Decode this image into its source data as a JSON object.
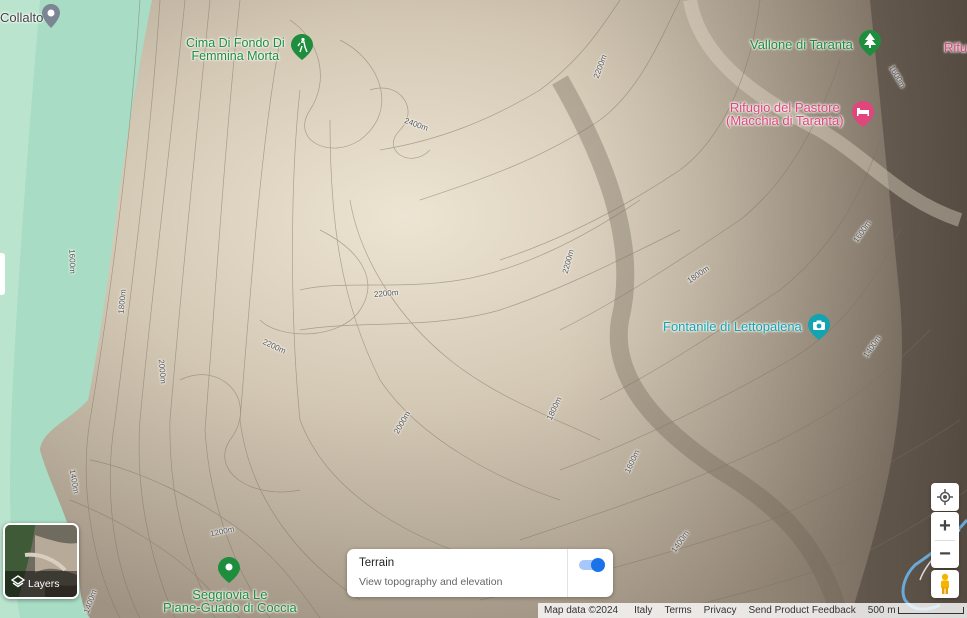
{
  "pois": {
    "collalto": "Collalto",
    "cima_line1": "Cima Di Fondo Di",
    "cima_line2": "Femmina Morta",
    "vallone": "Vallone di Taranta",
    "rifu": "Rifu",
    "rifugio_line1": "Rifugio del Pastore",
    "rifugio_line2": "(Macchia di Taranta)",
    "fontanile": "Fontanile di Lettopalena",
    "seggiovia_line1": "Seggiovia Le",
    "seggiovia_line2": "Piane-Guado di Coccia"
  },
  "contours": {
    "c2400": "2400m",
    "c2200a": "2200m",
    "c2200b": "2200m",
    "c2200c": "2200m",
    "c2200d": "2200m",
    "c2000a": "2000m",
    "c2000b": "2000m",
    "c1800a": "1800m",
    "c1800b": "1800m",
    "c1800c": "1800m",
    "c1600a": "1600m",
    "c1600b": "1600m",
    "c1600c": "1600m",
    "c1600d": "1600m",
    "c1400a": "1400m",
    "c1400b": "1400m",
    "c1400c": "1400m",
    "c1400d": "1400m",
    "c1200": "1200m"
  },
  "layers_label": "Layers",
  "terrain": {
    "title": "Terrain",
    "subtitle": "View topography and elevation",
    "enabled": true
  },
  "footer": {
    "map_data": "Map data ©2024",
    "country": "Italy",
    "terms": "Terms",
    "privacy": "Privacy",
    "feedback": "Send Product Feedback",
    "scale": "500 m"
  },
  "icons": {
    "collalto": "place-pin-icon",
    "cima": "hiking-icon",
    "vallone": "tree-icon",
    "rifugio": "lodging-icon",
    "fontanile": "camera-icon",
    "seggiovia": "place-pin-icon"
  },
  "colors": {
    "park_green": "#1e8e3e",
    "lodging_pink": "#e0457b",
    "attraction_teal": "#12a4b0",
    "toggle_blue": "#1a73e8"
  }
}
